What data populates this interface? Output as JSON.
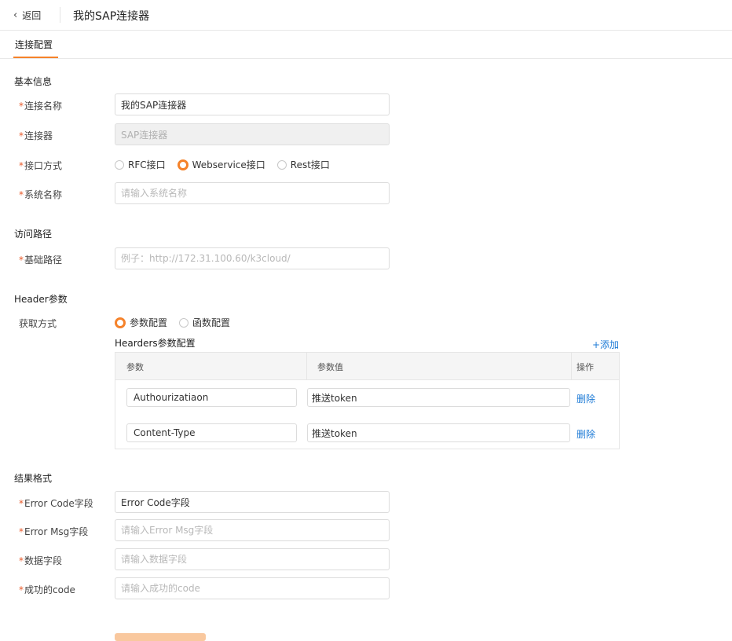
{
  "header": {
    "back_label": "返回",
    "back_icon": "chevron-left-icon",
    "title": "我的SAP连接器"
  },
  "tabs": [
    {
      "label": "连接配置",
      "active": true
    }
  ],
  "accent_color": "#f5822a",
  "link_color": "#1e7bd6",
  "basic": {
    "section_title": "基本信息",
    "name": {
      "label": "连接名称",
      "value": "我的SAP连接器"
    },
    "connector": {
      "label": "连接器",
      "value": "SAP连接器",
      "disabled": true
    },
    "interface": {
      "label": "接口方式",
      "options": [
        "RFC接口",
        "Webservice接口",
        "Rest接口"
      ],
      "selected": "Webservice接口"
    },
    "system_name": {
      "label": "系统名称",
      "placeholder": "请输入系统名称"
    }
  },
  "path": {
    "section_title": "访问路径",
    "base_path": {
      "label": "基础路径",
      "placeholder": "例子：http://172.31.100.60/k3cloud/"
    }
  },
  "header_params": {
    "section_title": "Header参数",
    "method_label": "获取方式",
    "options": [
      "参数配置",
      "函数配置"
    ],
    "selected": "参数配置",
    "table_title": "Hearders参数配置",
    "add_label": "+添加",
    "columns": [
      "参数",
      "参数值",
      "操作"
    ],
    "rows": [
      {
        "param": "Authourizatiaon",
        "value": "推送token",
        "action": "删除"
      },
      {
        "param": "Content-Type",
        "value": "推送token",
        "action": "删除"
      }
    ]
  },
  "result": {
    "section_title": "结果格式",
    "error_code": {
      "label": "Error Code字段",
      "value": "Error Code字段"
    },
    "error_msg": {
      "label": "Error Msg字段",
      "placeholder": "请输入Error Msg字段"
    },
    "data_field": {
      "label": "数据字段",
      "placeholder": "请输入数据字段"
    },
    "success_code": {
      "label": "成功的code",
      "placeholder": "请输入成功的code"
    }
  }
}
